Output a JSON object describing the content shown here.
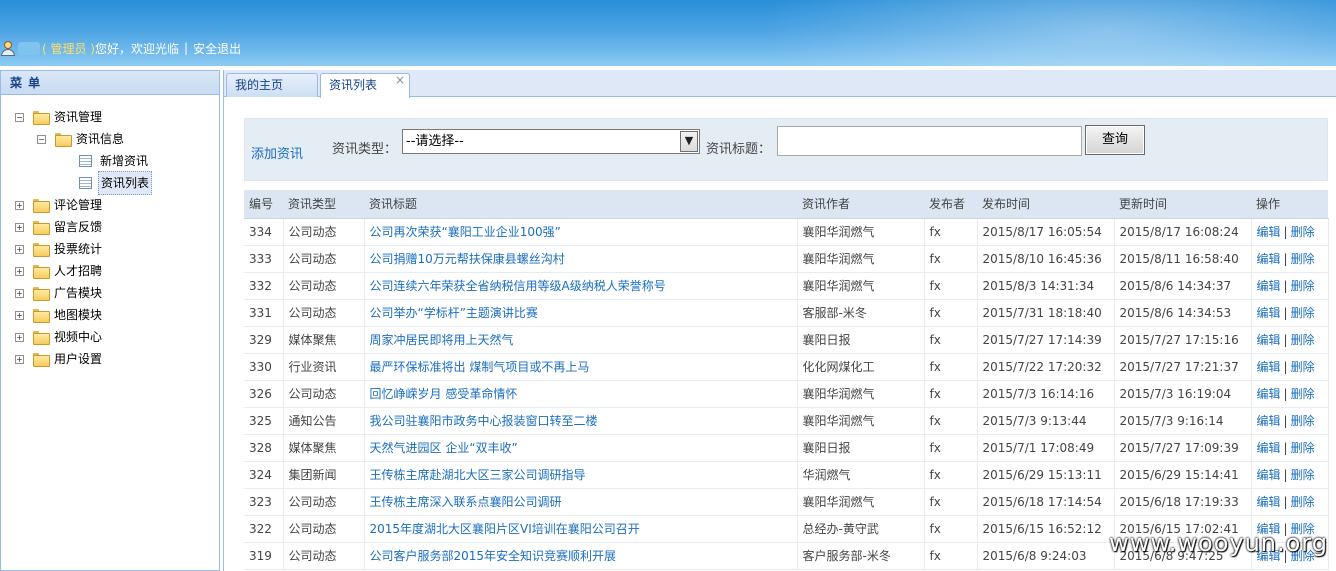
{
  "header": {
    "role": "( 管理员 )",
    "greeting": "您好，欢迎光临",
    "separator": "|",
    "logout": "安全退出"
  },
  "sidebar": {
    "title": "菜 单",
    "tree": [
      {
        "label": "资讯管理",
        "toggle": "−",
        "level": 0,
        "icon": "folder-icon"
      },
      {
        "label": "资讯信息",
        "toggle": "−",
        "level": 1,
        "icon": "folder-icon"
      },
      {
        "label": "新增资讯",
        "level": 2,
        "icon": "page-icon"
      },
      {
        "label": "资讯列表",
        "level": 2,
        "icon": "page-icon",
        "selected": true
      },
      {
        "label": "评论管理",
        "toggle": "+",
        "level": 0,
        "icon": "folder-icon"
      },
      {
        "label": "留言反馈",
        "toggle": "+",
        "level": 0,
        "icon": "folder-icon"
      },
      {
        "label": "投票统计",
        "toggle": "+",
        "level": 0,
        "icon": "folder-icon"
      },
      {
        "label": "人才招聘",
        "toggle": "+",
        "level": 0,
        "icon": "folder-icon"
      },
      {
        "label": "广告模块",
        "toggle": "+",
        "level": 0,
        "icon": "folder-icon"
      },
      {
        "label": "地图模块",
        "toggle": "+",
        "level": 0,
        "icon": "folder-icon"
      },
      {
        "label": "视频中心",
        "toggle": "+",
        "level": 0,
        "icon": "folder-icon"
      },
      {
        "label": "用户设置",
        "toggle": "+",
        "level": 0,
        "icon": "folder-icon"
      }
    ]
  },
  "tabs": {
    "home": "我的主页",
    "active": "资讯列表",
    "close": "×"
  },
  "toolbar": {
    "add": "添加资讯",
    "type_label": "资讯类型：",
    "type_selected": "--请选择--",
    "title_label": "资讯标题：",
    "title_value": "",
    "search": "查询"
  },
  "table": {
    "columns": [
      "编号",
      "资讯类型",
      "资讯标题",
      "资讯作者",
      "发布者",
      "发布时间",
      "更新时间",
      "操作"
    ],
    "edit": "编辑",
    "op_sep": "|",
    "delete": "删除",
    "rows": [
      [
        "334",
        "公司动态",
        "公司再次荣获“襄阳工业企业100强”",
        "襄阳华润燃气",
        "fx",
        "2015/8/17 16:05:54",
        "2015/8/17 16:08:24"
      ],
      [
        "333",
        "公司动态",
        "公司捐赠10万元帮扶保康县螺丝沟村",
        "襄阳华润燃气",
        "fx",
        "2015/8/10 16:45:36",
        "2015/8/11 16:58:40"
      ],
      [
        "332",
        "公司动态",
        "公司连续六年荣获全省纳税信用等级A级纳税人荣誉称号",
        "襄阳华润燃气",
        "fx",
        "2015/8/3 14:31:34",
        "2015/8/6 14:34:37"
      ],
      [
        "331",
        "公司动态",
        "公司举办“学标杆”主题演讲比赛",
        "客服部-米冬",
        "fx",
        "2015/7/31 18:18:40",
        "2015/8/6 14:34:53"
      ],
      [
        "329",
        "媒体聚焦",
        "周家冲居民即将用上天然气",
        "襄阳日报",
        "fx",
        "2015/7/27 17:14:39",
        "2015/7/27 17:15:16"
      ],
      [
        "330",
        "行业资讯",
        "最严环保标准将出 煤制气项目或不再上马",
        "化化网煤化工",
        "fx",
        "2015/7/22 17:20:32",
        "2015/7/27 17:21:37"
      ],
      [
        "326",
        "公司动态",
        "回忆峥嵘岁月 感受革命情怀",
        "襄阳华润燃气",
        "fx",
        "2015/7/3 16:14:16",
        "2015/7/3 16:19:04"
      ],
      [
        "325",
        "通知公告",
        "我公司驻襄阳市政务中心报装窗口转至二楼",
        "襄阳华润燃气",
        "fx",
        "2015/7/3 9:13:44",
        "2015/7/3 9:16:14"
      ],
      [
        "328",
        "媒体聚焦",
        "天然气进园区 企业“双丰收”",
        "襄阳日报",
        "fx",
        "2015/7/1 17:08:49",
        "2015/7/27 17:09:39"
      ],
      [
        "324",
        "集团新闻",
        "王传栋主席赴湖北大区三家公司调研指导",
        "华润燃气",
        "fx",
        "2015/6/29 15:13:11",
        "2015/6/29 15:14:41"
      ],
      [
        "323",
        "公司动态",
        "王传栋主席深入联系点襄阳公司调研",
        "襄阳华润燃气",
        "fx",
        "2015/6/18 17:14:54",
        "2015/6/18 17:19:33"
      ],
      [
        "322",
        "公司动态",
        "2015年度湖北大区襄阳片区VI培训在襄阳公司召开",
        "总经办-黄守武",
        "fx",
        "2015/6/15 16:52:12",
        "2015/6/15 17:02:41"
      ],
      [
        "319",
        "公司动态",
        "公司客户服务部2015年安全知识竞赛顺利开展",
        "客户服务部-米冬",
        "fx",
        "2015/6/8 9:24:03",
        "2015/6/8 9:47:25"
      ]
    ]
  },
  "watermark": "www.wooyun.org"
}
